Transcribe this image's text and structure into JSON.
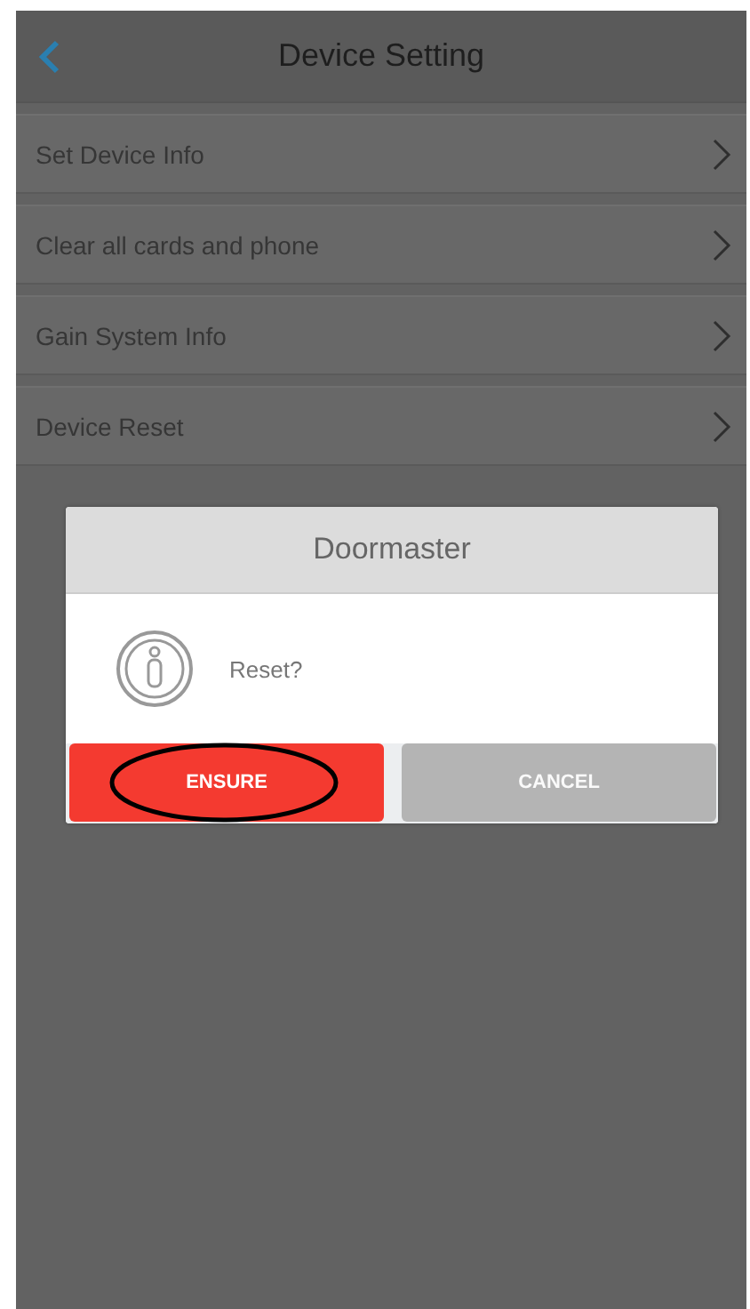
{
  "header": {
    "title": "Device Setting"
  },
  "menu_items": [
    {
      "label": "Set Device Info"
    },
    {
      "label": "Clear all cards and phone"
    },
    {
      "label": "Gain System Info"
    },
    {
      "label": "Device Reset"
    }
  ],
  "dialog": {
    "title": "Doormaster",
    "message": "Reset?",
    "buttons": [
      {
        "label": "ENSURE",
        "kind": "confirm",
        "circled": true
      },
      {
        "label": "CANCEL",
        "kind": "cancel",
        "circled": false
      }
    ]
  }
}
